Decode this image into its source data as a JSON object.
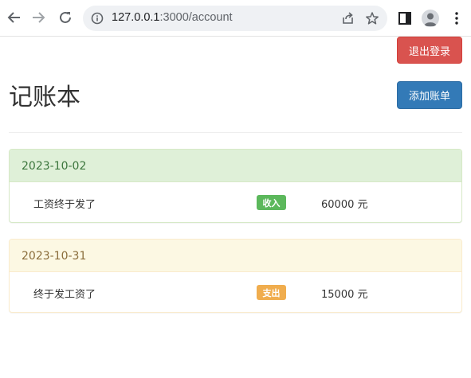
{
  "browser": {
    "url_host": "127.0.0.1",
    "url_rest": ":3000/account",
    "icons": [
      "back-arrow-icon",
      "forward-arrow-icon",
      "reload-icon",
      "info-icon",
      "share-icon",
      "star-icon",
      "side-panel-icon",
      "profile-icon",
      "more-menu-icon"
    ]
  },
  "header": {
    "title": "记账本",
    "logout_label": "退出登录",
    "add_label": "添加账单"
  },
  "colors": {
    "danger": "#d9534f",
    "primary": "#337ab7",
    "success": "#5cb85c",
    "warning": "#f0ad4e"
  },
  "accounts": [
    {
      "date": "2023-10-02",
      "title": "工资终于发了",
      "type": "收入",
      "amount": "60000 元",
      "status": "success"
    },
    {
      "date": "2023-10-31",
      "title": "终于发工资了",
      "type": "支出",
      "amount": "15000 元",
      "status": "warning"
    }
  ]
}
